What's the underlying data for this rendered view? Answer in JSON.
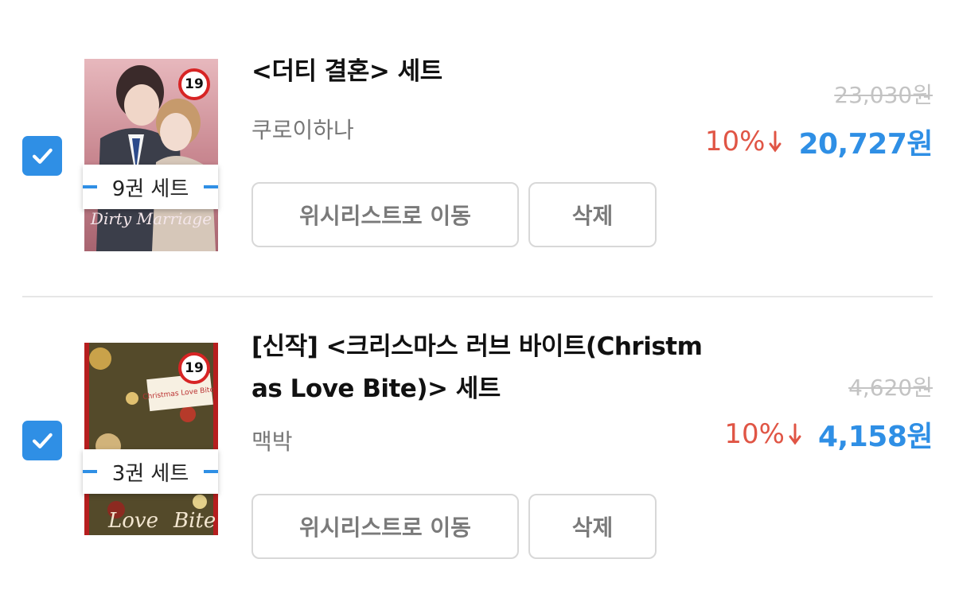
{
  "items": [
    {
      "checked": true,
      "title": "<더티 결혼> 세트",
      "author": "쿠로이하나",
      "set_label": "9권 세트",
      "age_rating": "19",
      "original_price": "23,030원",
      "discount": "10%",
      "sale_price": "20,727원",
      "wishlist_button": "위시리스트로 이동",
      "delete_button": "삭제"
    },
    {
      "checked": true,
      "title_line1": "[신작] <크리스마스 러브 바이트(Christm",
      "title_line2": "as Love Bite)> 세트",
      "author": "맥박",
      "set_label": "3권 세트",
      "age_rating": "19",
      "original_price": "4,620원",
      "discount": "10%",
      "sale_price": "4,158원",
      "wishlist_button": "위시리스트로 이동",
      "delete_button": "삭제"
    }
  ],
  "colors": {
    "accent": "#2f8fe5",
    "discount": "#e05545",
    "strike": "#c3c3c3"
  }
}
